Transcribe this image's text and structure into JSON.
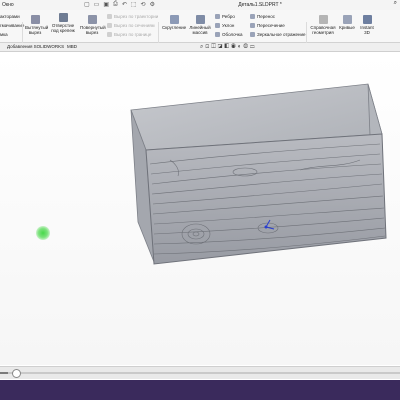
{
  "titlebar": {
    "left_label": "Окно",
    "document_title": "Деталь1.SLDPRT *",
    "search_icon": "search-icon"
  },
  "ribbon": {
    "col1": [
      "акторами",
      "гмачивание",
      "мка"
    ],
    "extrude_cut": "Вытянутый вырез",
    "hole_wizard": "Отверстие под крепеж",
    "revolve_cut": "Повернутый вырез",
    "disabled": [
      "Вырез по траектории",
      "Вырез по сечениям",
      "Вырез по границе"
    ],
    "fillet": "Скругление",
    "linear_pattern": "Линейный массив",
    "rib": "Ребро",
    "draft": "Уклон",
    "shell": "Оболочка",
    "wrap": "Перенос",
    "intersect": "Пересечение",
    "mirror": "Зеркальное отражение",
    "ref_geometry": "Справочная геометрия",
    "curves": "Кривые",
    "instant3d": "Instant 3D"
  },
  "tabs": [
    "Добавления SOLIDWORKS",
    "MBD"
  ],
  "playback": {
    "progress": 0.02
  },
  "colors": {
    "accent": "#3a2a5c",
    "cursor": "#47d84a",
    "model": "#a9acb2"
  }
}
